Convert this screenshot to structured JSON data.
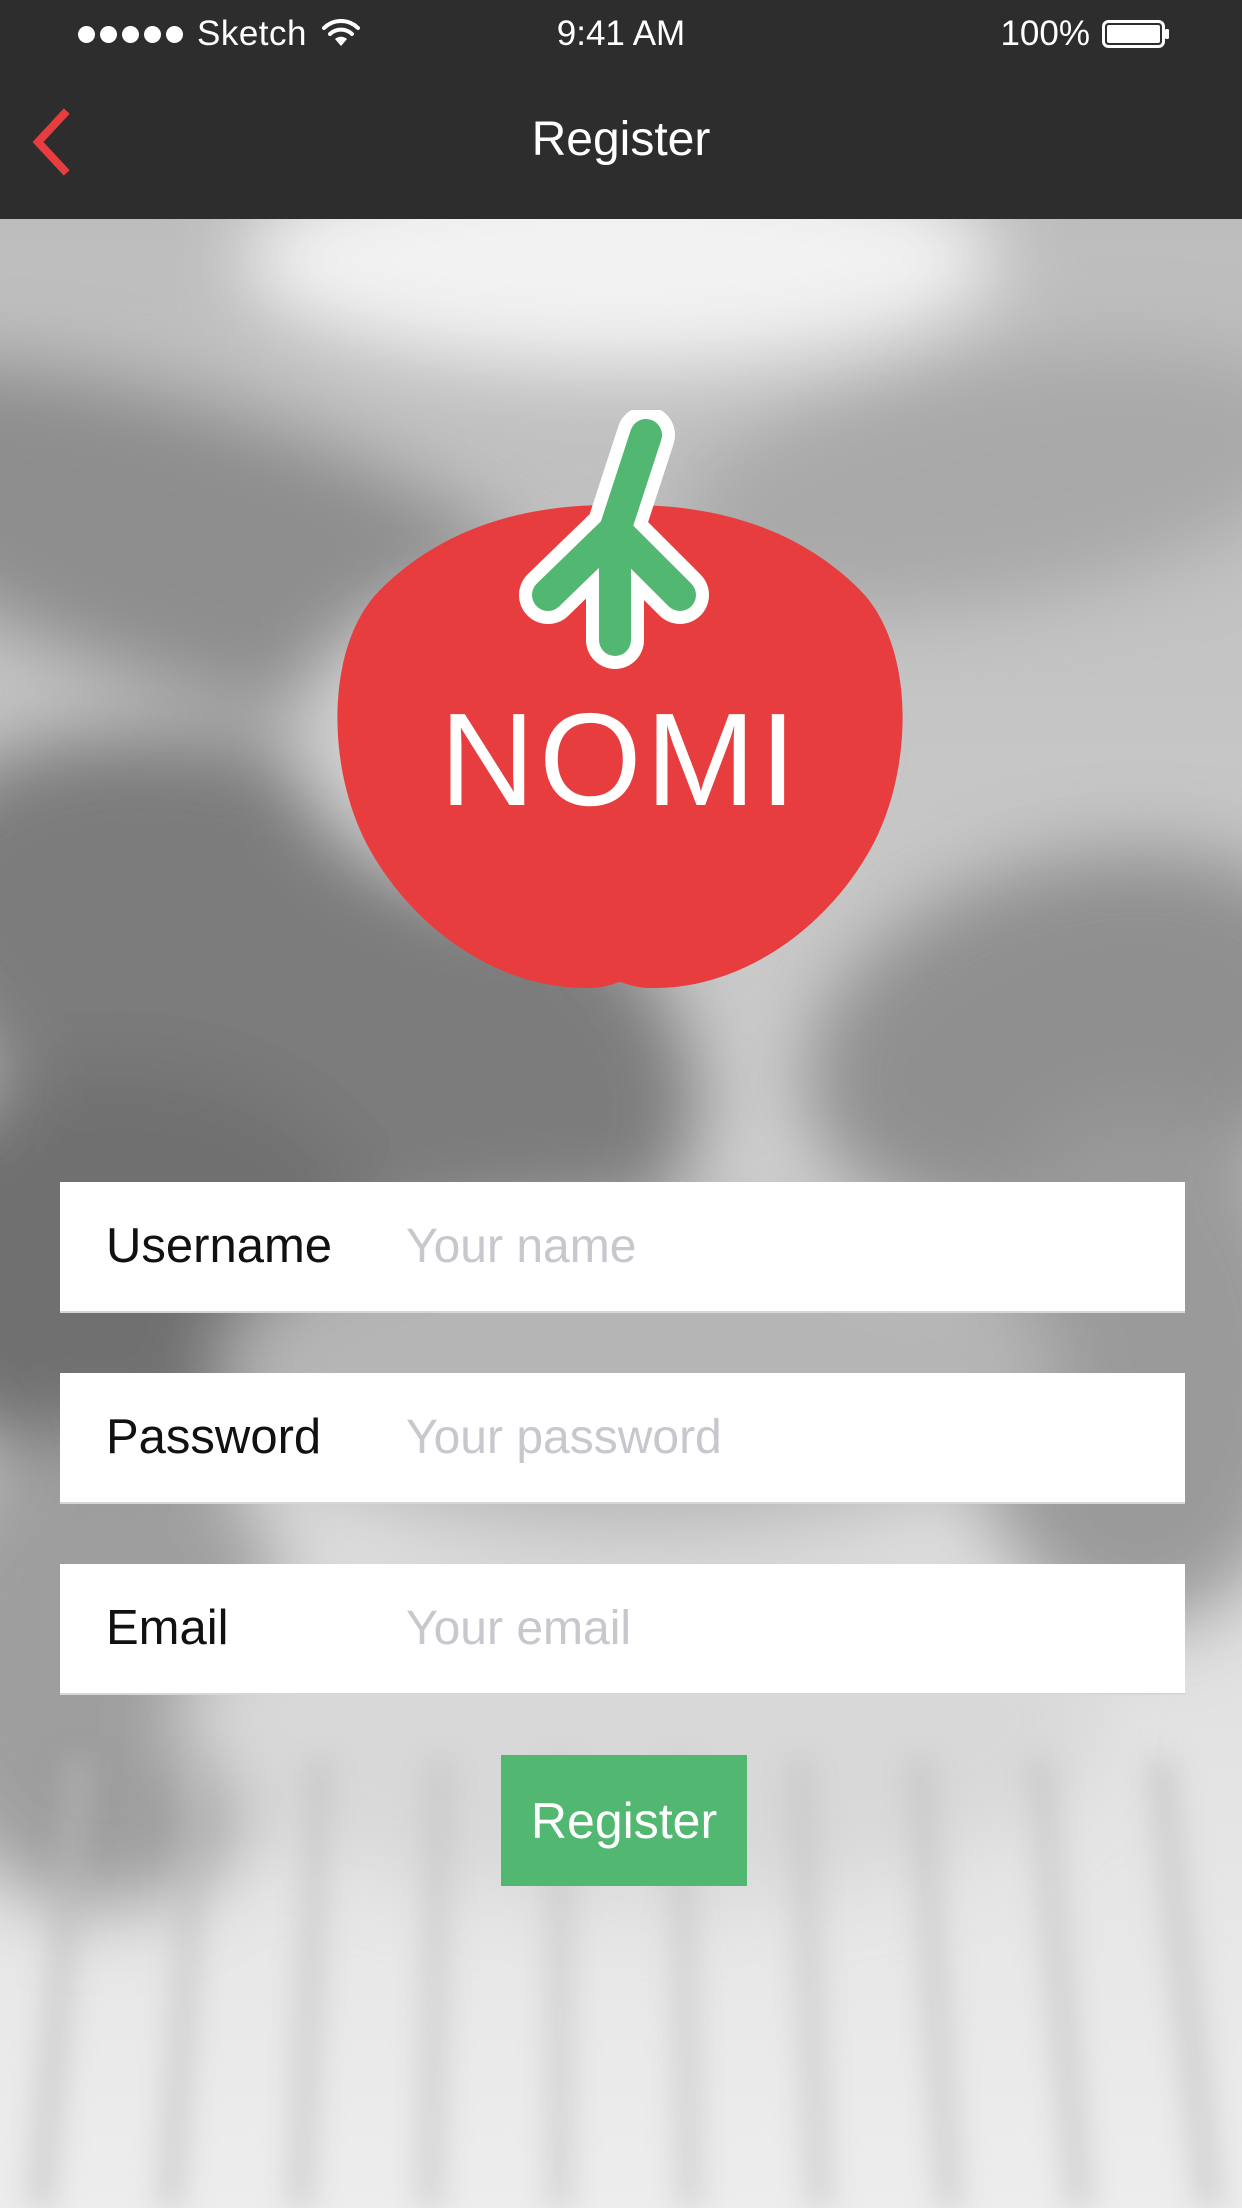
{
  "status_bar": {
    "carrier": "Sketch",
    "time": "9:41 AM",
    "battery": "100%"
  },
  "nav": {
    "title": "Register",
    "back_icon": "chevron-left-icon"
  },
  "logo": {
    "text": "NOMI",
    "colors": {
      "body": "#e83d3e",
      "stem": "#52b871"
    }
  },
  "form": {
    "username": {
      "label": "Username",
      "placeholder": "Your name",
      "value": ""
    },
    "password": {
      "label": "Password",
      "placeholder": "Your password",
      "value": ""
    },
    "email": {
      "label": "Email",
      "placeholder": "Your email",
      "value": ""
    },
    "submit_label": "Register"
  },
  "colors": {
    "bar_background": "#2d2d2d",
    "accent_red": "#e83d3e",
    "button_green": "#52b871"
  }
}
